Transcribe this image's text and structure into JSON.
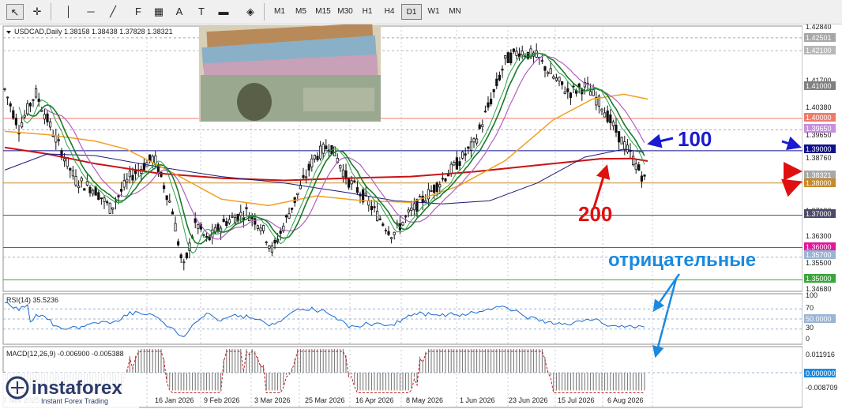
{
  "toolbar": {
    "tools": [
      {
        "name": "cursor-icon",
        "glyph": "↖"
      },
      {
        "name": "crosshair-icon",
        "glyph": "✛"
      },
      {
        "name": "vertical-line-icon",
        "glyph": "│"
      },
      {
        "name": "horizontal-line-icon",
        "glyph": "─"
      },
      {
        "name": "trendline-icon",
        "glyph": "╱"
      },
      {
        "name": "fibonacci-icon",
        "glyph": "F"
      },
      {
        "name": "channel-icon",
        "glyph": "▦"
      },
      {
        "name": "text-icon",
        "glyph": "A"
      },
      {
        "name": "text-label-icon",
        "glyph": "T"
      },
      {
        "name": "rectangle-icon",
        "glyph": "▬"
      },
      {
        "name": "arrows-icon",
        "glyph": "◈"
      }
    ],
    "timeframes": [
      "M1",
      "M5",
      "M15",
      "M30",
      "H1",
      "H4",
      "D1",
      "W1",
      "MN"
    ],
    "active_timeframe": "D1"
  },
  "chart": {
    "header": "USDCAD,Daily  1.38158 1.38438 1.37828 1.38321",
    "price_labels": [
      {
        "v": "1.42840",
        "key": "1.42840"
      },
      {
        "v": "1.41700",
        "key": "1.41700"
      },
      {
        "v": "1.40380",
        "key": "1.40380"
      },
      {
        "v": "1.39650",
        "key": "1.39650"
      },
      {
        "v": "1.38760",
        "key": "1.38760"
      },
      {
        "v": "1.37130",
        "key": "1.37130"
      },
      {
        "v": "1.36300",
        "key": "1.36300"
      },
      {
        "v": "1.35500",
        "key": "1.35500"
      },
      {
        "v": "1.34680",
        "key": "1.34680"
      }
    ],
    "level_boxes": [
      {
        "text": "1.42501",
        "color": "#a7a7a7"
      },
      {
        "text": "1.42100",
        "color": "#b8b8b8"
      },
      {
        "text": "1.41000",
        "color": "#808080"
      },
      {
        "text": "1.40000",
        "color": "#f07a6a"
      },
      {
        "text": "1.39650",
        "color": "#c88ee0"
      },
      {
        "text": "1.39000",
        "color": "#10108a"
      },
      {
        "text": "1.38321",
        "color": "#a8a8a8"
      },
      {
        "text": "1.38000",
        "color": "#c78a2a"
      },
      {
        "text": "1.37000",
        "color": "#4a4a6a"
      },
      {
        "text": "1.36000",
        "color": "#e0189a"
      },
      {
        "text": "1.35700",
        "color": "#9ab4d4"
      },
      {
        "text": "1.35000",
        "color": "#3aa53a"
      }
    ],
    "annotations": {
      "ma100": "100",
      "ma200": "200",
      "negative": "отрицательные"
    },
    "dates": [
      "7 Nov 2025",
      "16 Jan 2026",
      "9 Feb 2026",
      "3 Mar 2026",
      "25 Mar 2026",
      "16 Apr 2026",
      "8 May 2026",
      "1 Jun 2026",
      "23 Jun 2026",
      "15 Jul 2026",
      "6 Aug 2026"
    ],
    "logo": {
      "brand": "instaforex",
      "tagline": "Instant Forex Trading"
    }
  },
  "rsi": {
    "header": "RSI(14) 35.5236",
    "scale": [
      "100",
      "70",
      "30",
      "0"
    ],
    "level_box": "50.0000"
  },
  "macd": {
    "header": "MACD(12,26,9) -0.006900 -0.005388",
    "scale_top": "0.011916",
    "level_box": "0.000000",
    "scale_bottom": "-0.008709"
  },
  "colors": {
    "ma_red": "#cc1111",
    "ma_navy": "#1a1a7a",
    "ma_orange": "#f0a020",
    "ma_green": "#1a7a2a",
    "ma_lime": "#2fa04a",
    "ma_purple": "#b060c0",
    "arrow_blue": "#1a1ad0",
    "arrow_red": "#e01010",
    "arrow_cyan": "#1a8ae0"
  }
}
